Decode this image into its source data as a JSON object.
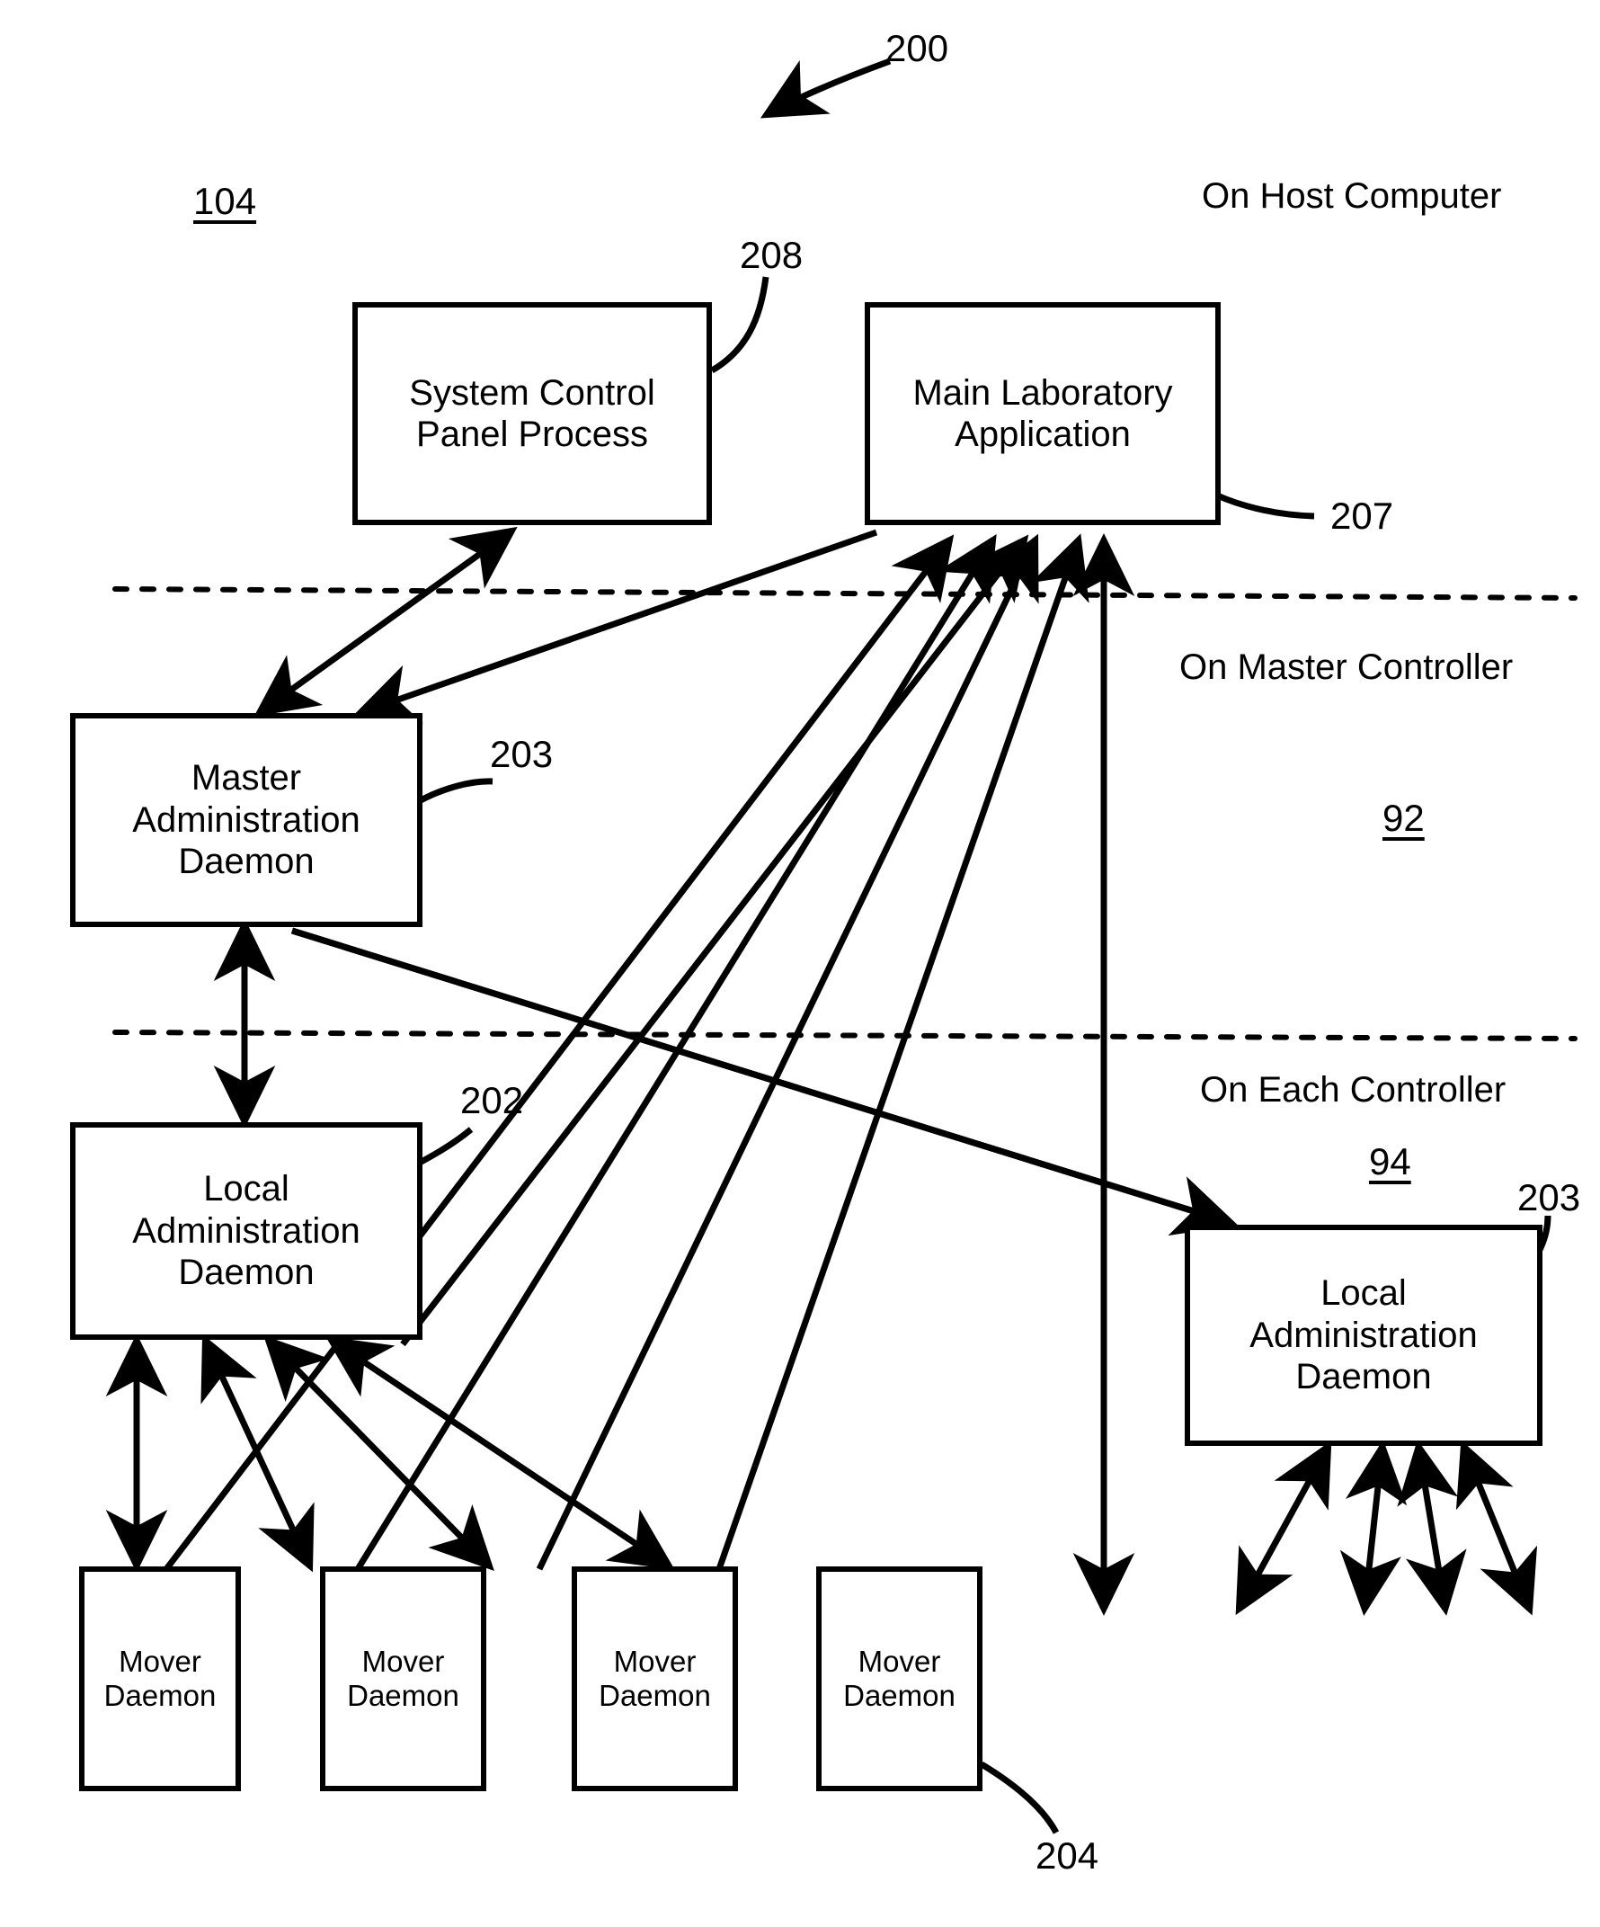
{
  "figure": {
    "number": "200",
    "zone_labels": [
      {
        "id": "host",
        "text": "On Host Computer"
      },
      {
        "id": "master",
        "text": "On Master Controller"
      },
      {
        "id": "each",
        "text": "On Each Controller"
      }
    ],
    "reference_numerals": [
      {
        "id": "ref-104",
        "text": "104",
        "underlined": true
      },
      {
        "id": "ref-200",
        "text": "200",
        "underlined": false
      },
      {
        "id": "ref-208",
        "text": "208",
        "underlined": false
      },
      {
        "id": "ref-207",
        "text": "207",
        "underlined": false
      },
      {
        "id": "ref-203-master",
        "text": "203",
        "underlined": false
      },
      {
        "id": "ref-92",
        "text": "92",
        "underlined": true
      },
      {
        "id": "ref-202",
        "text": "202",
        "underlined": false
      },
      {
        "id": "ref-94",
        "text": "94",
        "underlined": true
      },
      {
        "id": "ref-203-local",
        "text": "203",
        "underlined": false
      },
      {
        "id": "ref-204",
        "text": "204",
        "underlined": false
      }
    ],
    "nodes": [
      {
        "id": "system-control-panel-process",
        "label": "System Control\nPanel Process"
      },
      {
        "id": "main-laboratory-application",
        "label": "Main Laboratory\nApplication"
      },
      {
        "id": "master-administration-daemon",
        "label": "Master\nAdministration\nDaemon"
      },
      {
        "id": "local-administration-daemon-left",
        "label": "Local\nAdministration\nDaemon"
      },
      {
        "id": "local-administration-daemon-right",
        "label": "Local\nAdministration\nDaemon"
      },
      {
        "id": "mover-daemon-1",
        "label": "Mover\nDaemon"
      },
      {
        "id": "mover-daemon-2",
        "label": "Mover\nDaemon"
      },
      {
        "id": "mover-daemon-3",
        "label": "Mover\nDaemon"
      },
      {
        "id": "mover-daemon-4",
        "label": "Mover\nDaemon"
      }
    ],
    "colors": {
      "ink": "#000000",
      "paper": "#ffffff"
    }
  }
}
